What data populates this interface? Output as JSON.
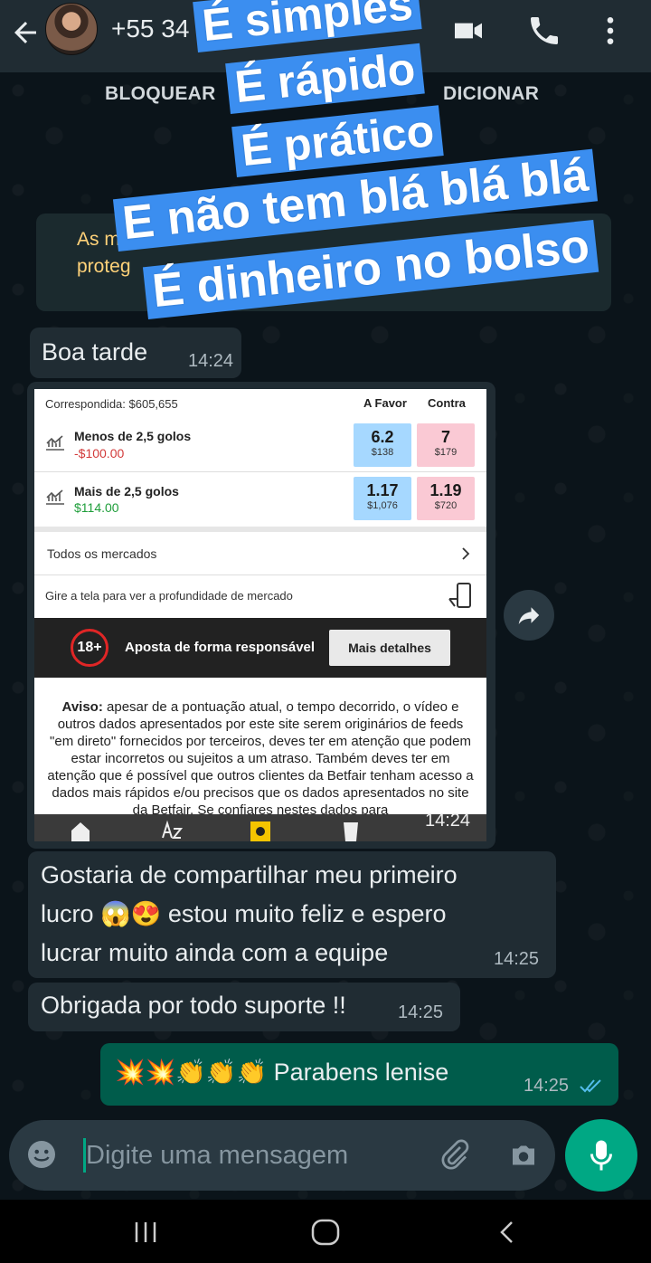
{
  "header": {
    "contact_name": "+55 34 9",
    "actions": {
      "block": "BLOQUEAR",
      "add": "DICIONAR"
    }
  },
  "encryption_note": "As mensa... protege...",
  "encryption_lines": [
    "As mensa",
    "proteg"
  ],
  "banner": [
    "É simples",
    "É rápido",
    "É prático",
    "E não tem blá blá blá",
    "É dinheiro no bolso"
  ],
  "messages": {
    "greeting": {
      "text": "Boa tarde",
      "time": "14:24"
    },
    "image_time": "14:24",
    "share": {
      "lines": [
        "Gostaria de compartilhar meu primeiro",
        "lucro",
        "estou muito feliz e espero",
        "lucrar muito ainda com a equipe"
      ],
      "emoji1": "😱",
      "emoji2": "😍",
      "time": "14:25"
    },
    "thanks": {
      "text": "Obrigada por todo suporte !!",
      "time": "14:25"
    },
    "reply": {
      "emojis": "💥💥👏👏👏",
      "text": "Parabens lenise",
      "time": "14:25"
    }
  },
  "screenshot": {
    "matched": "Correspondida: $605,655",
    "col_back": "A Favor",
    "col_lay": "Contra",
    "runners": [
      {
        "name": "Menos de 2,5 golos",
        "pl": "-$100.00",
        "back_odds": "6.2",
        "back_size": "$138",
        "lay_odds": "7",
        "lay_size": "$179"
      },
      {
        "name": "Mais de 2,5 golos",
        "pl": "$114.00",
        "back_odds": "1.17",
        "back_size": "$1,076",
        "lay_odds": "1.19",
        "lay_size": "$720"
      }
    ],
    "all_markets": "Todos os mercados",
    "rotate_hint": "Gire a tela para ver a profundidade de mercado",
    "age_badge": "18+",
    "responsible": "Aposta de forma responsável",
    "more_details": "Mais detalhes",
    "warning_label": "Aviso:",
    "warning_text": "apesar de a pontuação atual, o tempo decorrido, o vídeo e outros dados apresentados por este site serem originários de feeds \"em direto\" fornecidos por terceiros, deves ter em atenção que podem estar incorretos ou sujeitos a um atraso.  Também deves ter em atenção que é possível que outros clientes da Betfair tenham acesso a dados mais rápidos e/ou precisos que os dados apresentados no site da Betfair. Se confiares nestes dados para"
  },
  "input": {
    "placeholder": "Digite uma mensagem"
  },
  "colors": {
    "header": "#202c33",
    "outgoing": "#005c4b",
    "incoming": "#202c33",
    "accent": "#00a884",
    "banner": "#3b8ef0"
  }
}
